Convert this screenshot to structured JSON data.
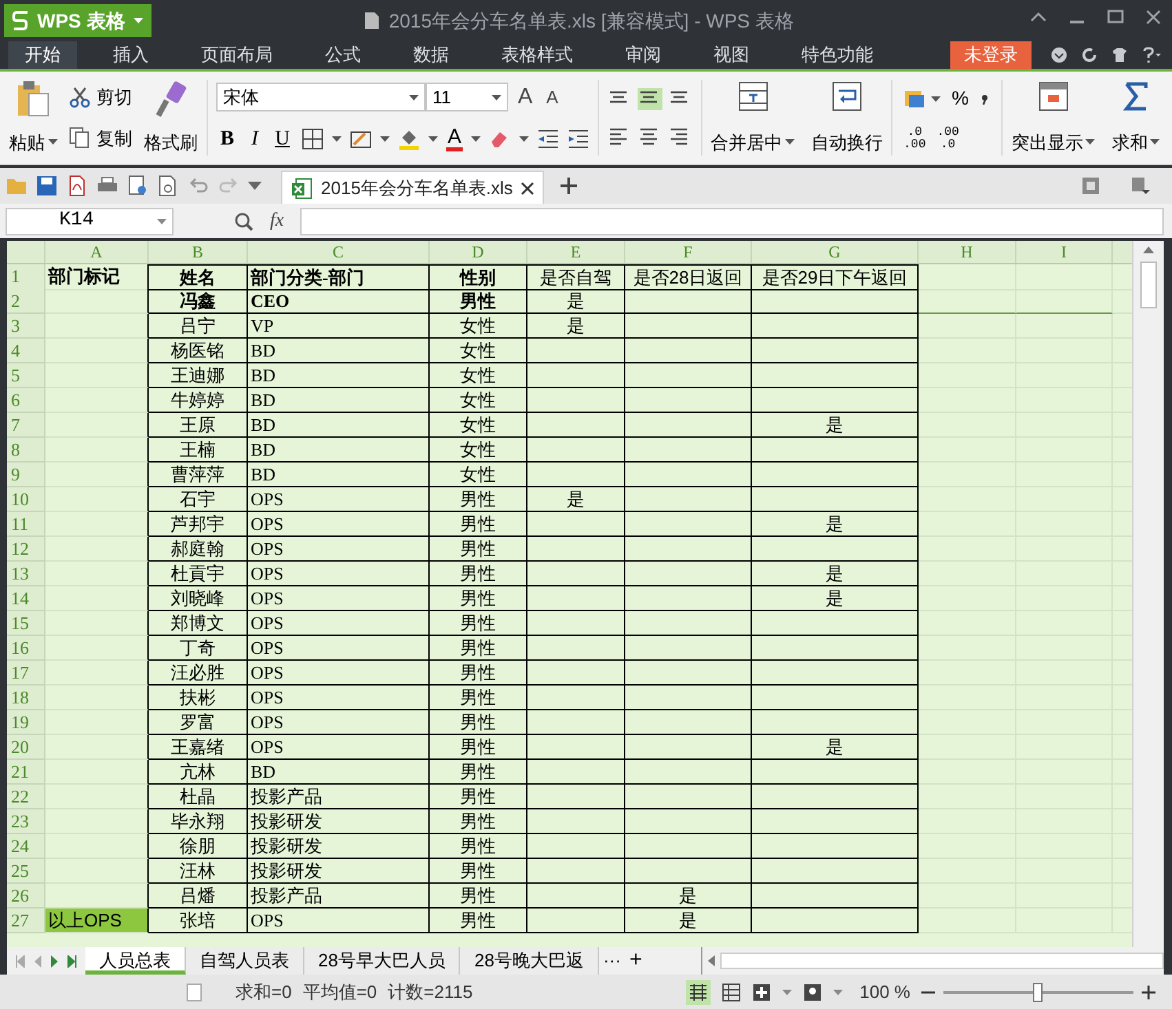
{
  "title_bar": {
    "app_menu": "WPS 表格",
    "title": "2015年会分车名单表.xls [兼容模式] - WPS 表格"
  },
  "menu_tabs": [
    {
      "label": "开始",
      "selected": true
    },
    {
      "label": "插入",
      "selected": false
    },
    {
      "label": "页面布局",
      "selected": false
    },
    {
      "label": "公式",
      "selected": false
    },
    {
      "label": "数据",
      "selected": false
    },
    {
      "label": "表格样式",
      "selected": false
    },
    {
      "label": "审阅",
      "selected": false
    },
    {
      "label": "视图",
      "selected": false
    },
    {
      "label": "特色功能",
      "selected": false
    }
  ],
  "login_button": "未登录",
  "ribbon": {
    "paste": "粘贴",
    "cut": "剪切",
    "copy": "复制",
    "format_painter": "格式刷",
    "font": "宋体",
    "font_size": "11",
    "grow_font": "A",
    "shrink_font": "A",
    "bold": "B",
    "italic": "I",
    "underline": "U",
    "font_color": "A",
    "merge_center": "合并居中",
    "wrap_text": "自动换行",
    "percent": "%",
    "decimals": [
      ".0",
      ".00",
      ".00",
      ".0"
    ],
    "highlight": "突出显示",
    "sum": "求和"
  },
  "document_tab": {
    "title": "2015年会分车名单表.xls"
  },
  "formula_bar": {
    "name_box": "K14",
    "fx": "fx"
  },
  "columns": [
    "A",
    "B",
    "C",
    "D",
    "E",
    "F",
    "G",
    "H",
    "I"
  ],
  "rows": [
    {
      "number": "1",
      "cells": [
        {
          "text": "部门标记",
          "bold": true
        },
        {
          "text": "姓名",
          "bold": true
        },
        {
          "text": "部门分类-部门",
          "bold": true
        },
        {
          "text": "性别",
          "bold": true
        },
        {
          "text": "是否自驾",
          "bold": false
        },
        {
          "text": "是否28日返回",
          "bold": false
        },
        {
          "text": "是否29日下午返回",
          "bold": false
        }
      ]
    },
    {
      "number": "2",
      "cells": [
        null,
        {
          "text": "冯鑫",
          "bold": true
        },
        {
          "text": "CEO",
          "bold": true
        },
        {
          "text": "男性",
          "bold": true
        },
        {
          "text": "是",
          "bold": false
        }
      ]
    },
    {
      "number": "3",
      "cells": [
        null,
        {
          "text": "吕宁",
          "bold": false
        },
        {
          "text": "VP",
          "bold": false
        },
        {
          "text": "女性",
          "bold": false
        },
        {
          "text": "是",
          "bold": false
        }
      ]
    },
    {
      "number": "4",
      "cells": [
        null,
        {
          "text": "杨医铭",
          "bold": false
        },
        {
          "text": "BD",
          "bold": false
        },
        {
          "text": "女性",
          "bold": false
        }
      ]
    },
    {
      "number": "5",
      "cells": [
        null,
        {
          "text": "王迪娜",
          "bold": false
        },
        {
          "text": "BD",
          "bold": false
        },
        {
          "text": "女性",
          "bold": false
        }
      ]
    },
    {
      "number": "6",
      "cells": [
        null,
        {
          "text": "牛婷婷",
          "bold": false
        },
        {
          "text": "BD",
          "bold": false
        },
        {
          "text": "女性",
          "bold": false
        }
      ]
    },
    {
      "number": "7",
      "cells": [
        null,
        {
          "text": "王原",
          "bold": false
        },
        {
          "text": "BD",
          "bold": false
        },
        {
          "text": "女性",
          "bold": false
        },
        null,
        null,
        {
          "text": "是",
          "bold": false
        }
      ]
    },
    {
      "number": "8",
      "cells": [
        null,
        {
          "text": "王楠",
          "bold": false
        },
        {
          "text": "BD",
          "bold": false
        },
        {
          "text": "女性",
          "bold": false
        }
      ]
    },
    {
      "number": "9",
      "cells": [
        null,
        {
          "text": "曹萍萍",
          "bold": false
        },
        {
          "text": "BD",
          "bold": false
        },
        {
          "text": "女性",
          "bold": false
        }
      ]
    },
    {
      "number": "10",
      "cells": [
        null,
        {
          "text": "石宇",
          "bold": false
        },
        {
          "text": "OPS",
          "bold": false
        },
        {
          "text": "男性",
          "bold": false
        },
        {
          "text": "是",
          "bold": false
        }
      ]
    },
    {
      "number": "11",
      "cells": [
        null,
        {
          "text": "芦邦宇",
          "bold": false
        },
        {
          "text": "OPS",
          "bold": false
        },
        {
          "text": "男性",
          "bold": false
        },
        null,
        null,
        {
          "text": "是",
          "bold": false
        }
      ]
    },
    {
      "number": "12",
      "cells": [
        null,
        {
          "text": "郝庭翰",
          "bold": false
        },
        {
          "text": "OPS",
          "bold": false
        },
        {
          "text": "男性",
          "bold": false
        }
      ]
    },
    {
      "number": "13",
      "cells": [
        null,
        {
          "text": "杜貢宇",
          "bold": false
        },
        {
          "text": "OPS",
          "bold": false
        },
        {
          "text": "男性",
          "bold": false
        },
        null,
        null,
        {
          "text": "是",
          "bold": false
        }
      ]
    },
    {
      "number": "14",
      "cells": [
        null,
        {
          "text": "刘晓峰",
          "bold": false
        },
        {
          "text": "OPS",
          "bold": false
        },
        {
          "text": "男性",
          "bold": false
        },
        null,
        null,
        {
          "text": "是",
          "bold": false
        }
      ]
    },
    {
      "number": "15",
      "cells": [
        null,
        {
          "text": "郑博文",
          "bold": false
        },
        {
          "text": "OPS",
          "bold": false
        },
        {
          "text": "男性",
          "bold": false
        }
      ]
    },
    {
      "number": "16",
      "cells": [
        null,
        {
          "text": "丁奇",
          "bold": false
        },
        {
          "text": "OPS",
          "bold": false
        },
        {
          "text": "男性",
          "bold": false
        }
      ]
    },
    {
      "number": "17",
      "cells": [
        null,
        {
          "text": "汪必胜",
          "bold": false
        },
        {
          "text": "OPS",
          "bold": false
        },
        {
          "text": "男性",
          "bold": false
        }
      ]
    },
    {
      "number": "18",
      "cells": [
        null,
        {
          "text": "扶彬",
          "bold": false
        },
        {
          "text": "OPS",
          "bold": false
        },
        {
          "text": "男性",
          "bold": false
        }
      ]
    },
    {
      "number": "19",
      "cells": [
        null,
        {
          "text": "罗富",
          "bold": false
        },
        {
          "text": "OPS",
          "bold": false
        },
        {
          "text": "男性",
          "bold": false
        }
      ]
    },
    {
      "number": "20",
      "cells": [
        null,
        {
          "text": "王嘉绪",
          "bold": false
        },
        {
          "text": "OPS",
          "bold": false
        },
        {
          "text": "男性",
          "bold": false
        },
        null,
        null,
        {
          "text": "是",
          "bold": false
        }
      ]
    },
    {
      "number": "21",
      "cells": [
        null,
        {
          "text": "亢林",
          "bold": false
        },
        {
          "text": "BD",
          "bold": false
        },
        {
          "text": "男性",
          "bold": false
        }
      ]
    },
    {
      "number": "22",
      "cells": [
        null,
        {
          "text": "杜晶",
          "bold": false
        },
        {
          "text": "投影产品",
          "bold": false
        },
        {
          "text": "男性",
          "bold": false
        }
      ]
    },
    {
      "number": "23",
      "cells": [
        null,
        {
          "text": "毕永翔",
          "bold": false
        },
        {
          "text": "投影研发",
          "bold": false
        },
        {
          "text": "男性",
          "bold": false
        }
      ]
    },
    {
      "number": "24",
      "cells": [
        null,
        {
          "text": "徐朋",
          "bold": false
        },
        {
          "text": "投影研发",
          "bold": false
        },
        {
          "text": "男性",
          "bold": false
        }
      ]
    },
    {
      "number": "25",
      "cells": [
        null,
        {
          "text": "汪林",
          "bold": false
        },
        {
          "text": "投影研发",
          "bold": false
        },
        {
          "text": "男性",
          "bold": false
        }
      ]
    },
    {
      "number": "26",
      "cells": [
        null,
        {
          "text": "吕燔",
          "bold": false
        },
        {
          "text": "投影产品",
          "bold": false
        },
        {
          "text": "男性",
          "bold": false
        },
        null,
        {
          "text": "是",
          "bold": false
        }
      ]
    },
    {
      "number": "27",
      "cells": [
        {
          "text": "以上OPS",
          "bold": false,
          "color": "#8dc63f"
        },
        {
          "text": "张培",
          "bold": false
        },
        {
          "text": "OPS",
          "bold": false
        },
        {
          "text": "男性",
          "bold": false
        },
        null,
        {
          "text": "是",
          "bold": false
        }
      ]
    }
  ],
  "sheet_tabs": [
    {
      "label": "人员总表",
      "selected": true
    },
    {
      "label": "自驾人员表",
      "selected": false
    },
    {
      "label": "28号早大巴人员",
      "selected": false
    },
    {
      "label": "28号晚大巴返",
      "selected": false
    }
  ],
  "sheet_more": "···",
  "sheet_add": "+",
  "status_bar": {
    "sum": "求和=0",
    "average": "平均值=0",
    "count": "计数=2115",
    "zoom": "100 %",
    "zoom_slider": {
      "level": 0.49
    }
  }
}
